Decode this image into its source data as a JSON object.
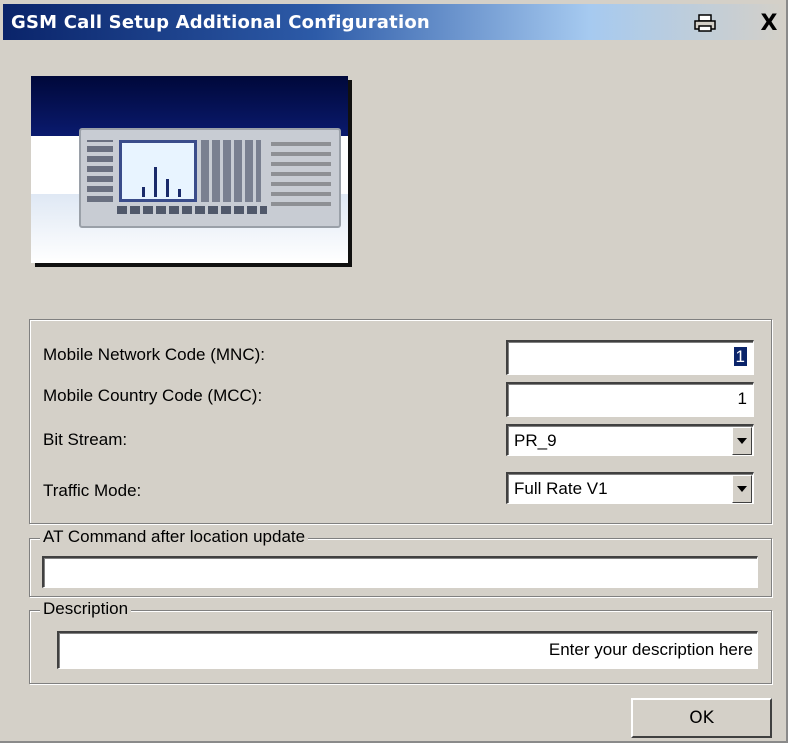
{
  "window": {
    "title": "GSM Call Setup Additional Configuration",
    "close_glyph": "X",
    "print_icon": "print-icon"
  },
  "image": {
    "name": "instrument-photo"
  },
  "settings": {
    "mnc_label": "Mobile Network Code (MNC):",
    "mnc_value": "1",
    "mcc_label": "Mobile Country Code (MCC):",
    "mcc_value": "1",
    "bitstream_label": "Bit Stream:",
    "bitstream_value": "PR_9",
    "traffic_label": "Traffic Mode:",
    "traffic_value": "Full Rate V1"
  },
  "at_command": {
    "legend": "AT Command after location update",
    "value": ""
  },
  "description": {
    "legend": "Description",
    "value": "Enter your description here"
  },
  "buttons": {
    "ok_label": "OK"
  },
  "colors": {
    "titlebar_start": "#0a246a",
    "dialog_bg": "#d4d0c8",
    "selection": "#0a246a"
  }
}
